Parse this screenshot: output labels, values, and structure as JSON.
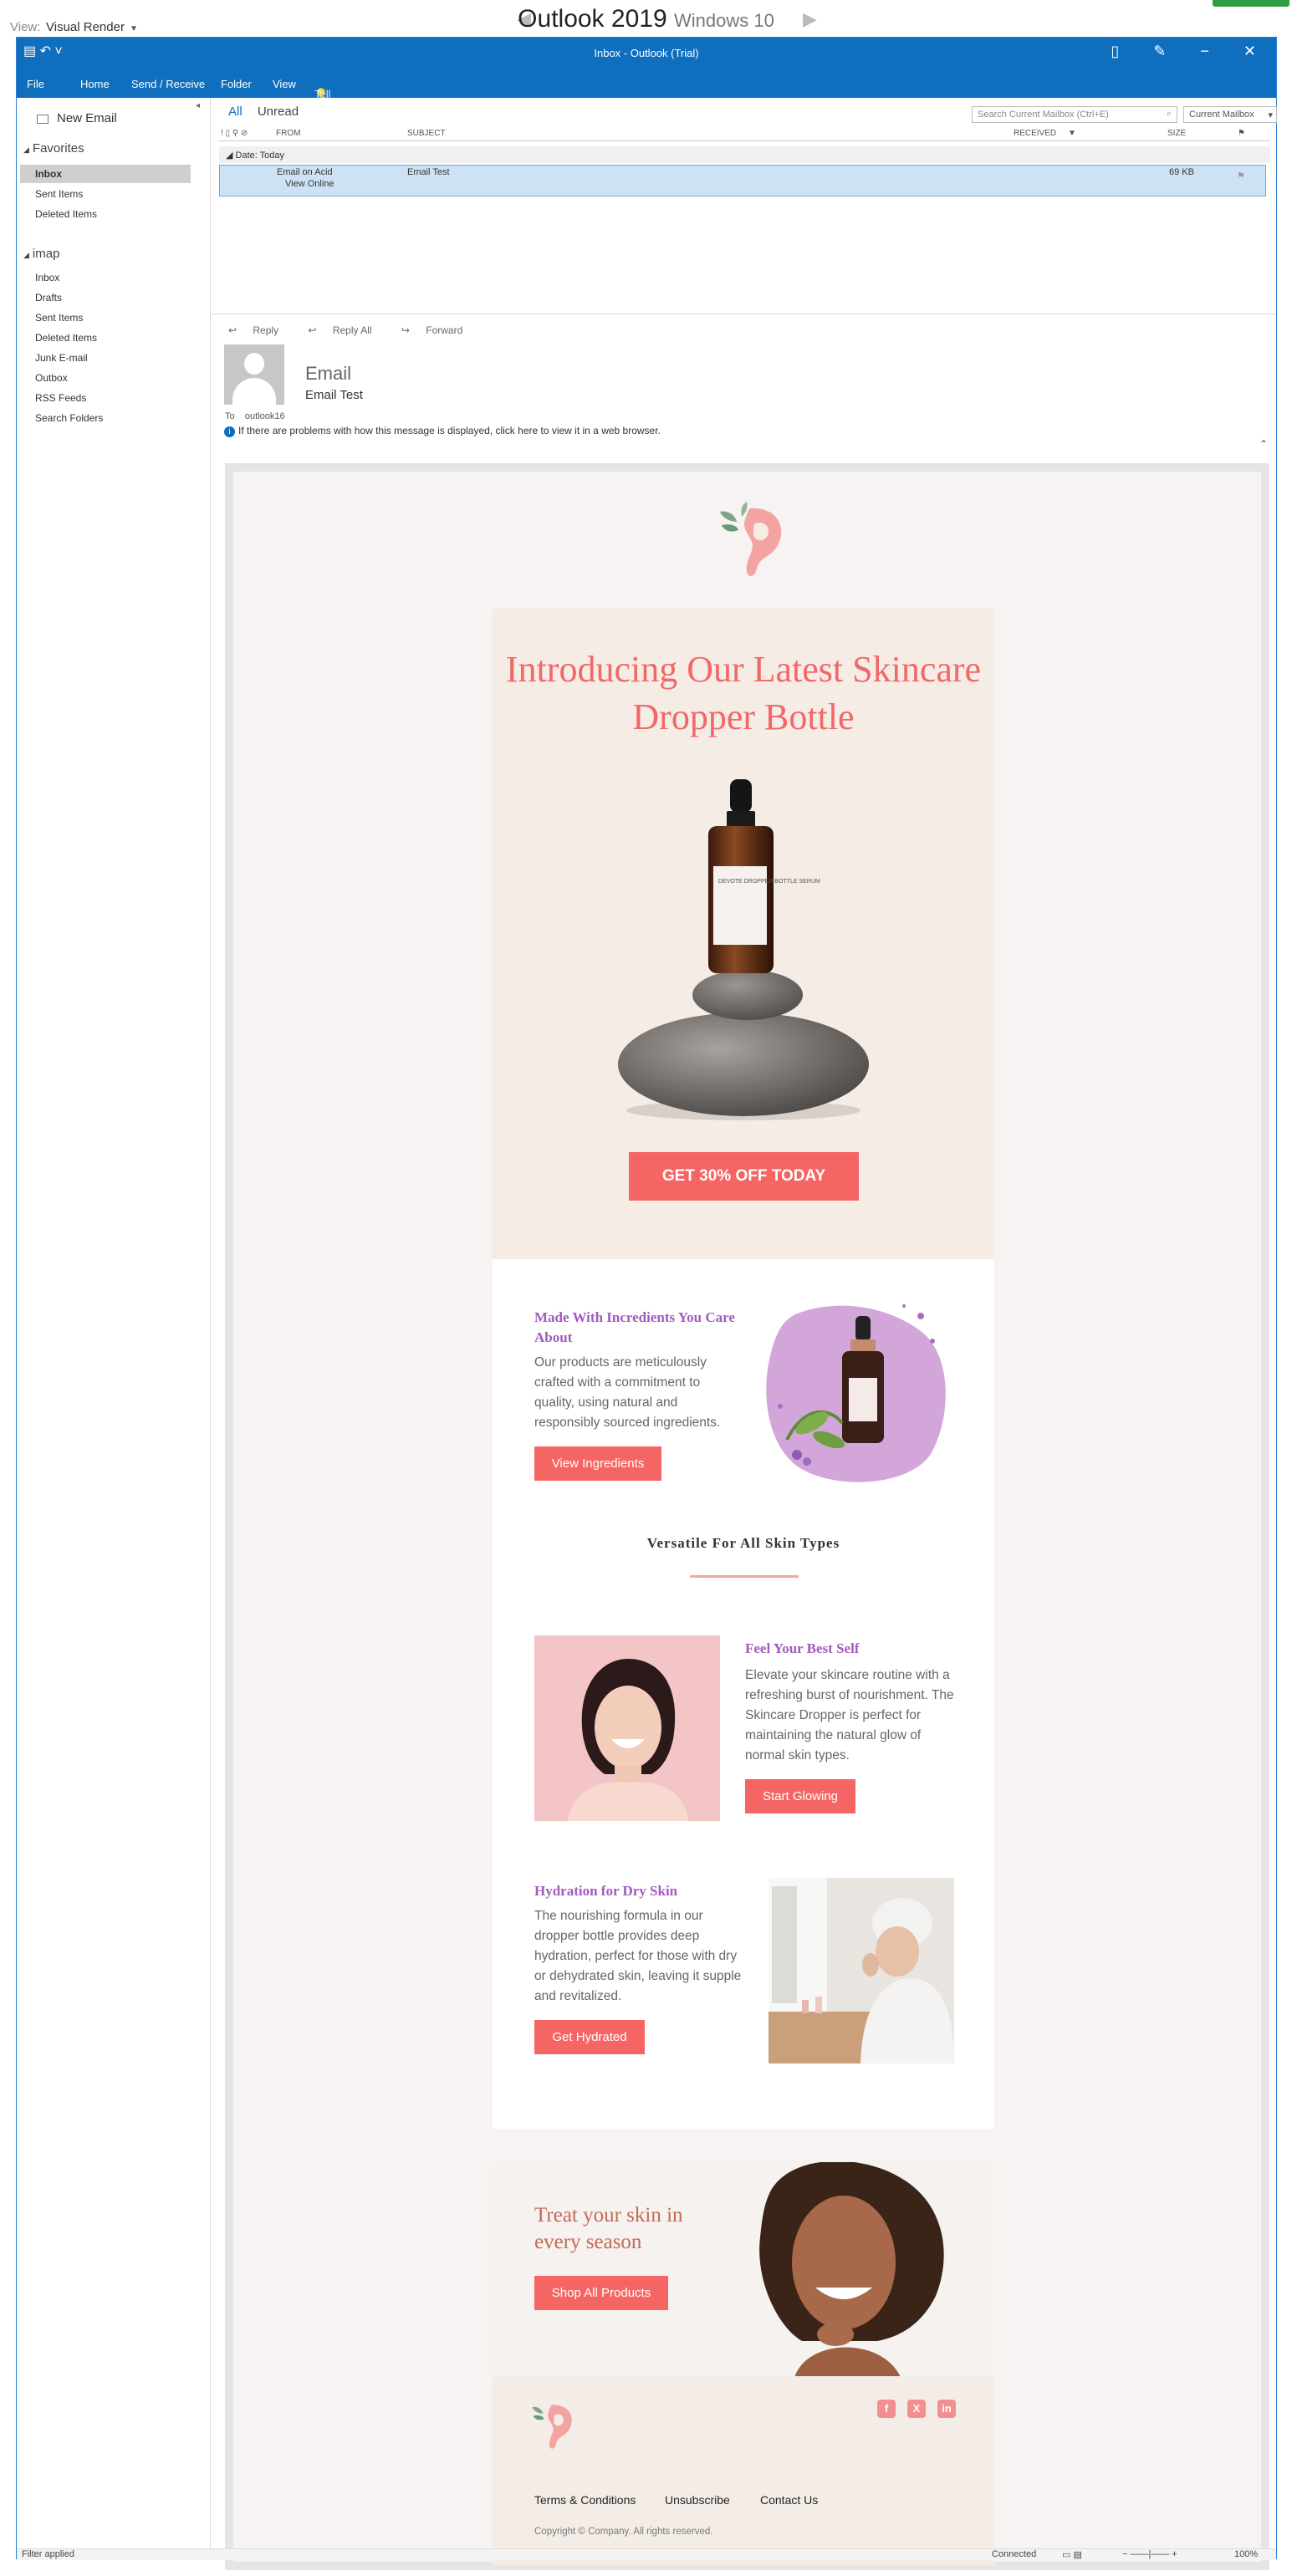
{
  "preview": {
    "view_label": "View:",
    "view_value": "Visual Render",
    "client": "Outlook 2019",
    "os": "Windows 10"
  },
  "window": {
    "title": "Inbox - Outlook (Trial)"
  },
  "ribbon": {
    "tabs": [
      "File",
      "Home",
      "Send / Receive",
      "Folder",
      "View"
    ],
    "tell_me": "Tell me what you want to do..."
  },
  "nav": {
    "new_email": "New Email",
    "favorites": "Favorites",
    "favorites_items": [
      "Inbox",
      "Sent Items",
      "Deleted Items"
    ],
    "account": "imap",
    "account_items": [
      "Inbox",
      "Drafts",
      "Sent Items",
      "Deleted Items",
      "Junk E-mail",
      "Outbox",
      "RSS Feeds",
      "Search Folders"
    ]
  },
  "list": {
    "filter_all": "All",
    "filter_unread": "Unread",
    "search_placeholder": "Search Current Mailbox (Ctrl+E)",
    "mailbox_scope": "Current Mailbox",
    "col_from": "FROM",
    "col_subject": "SUBJECT",
    "col_received": "RECEIVED",
    "col_size": "SIZE",
    "group": "Date: Today",
    "row": {
      "from": "Email on Acid",
      "view_online": "View Online",
      "subject": "Email Test",
      "size": "69 KB"
    }
  },
  "reading": {
    "actions": [
      "Reply",
      "Reply All",
      "Forward"
    ],
    "sender": "Email",
    "subject": "Email Test",
    "to_label": "To",
    "to_value": "outlook16",
    "info": "If there are problems with how this message is displayed, click here to view it in a web browser."
  },
  "email": {
    "hero_title": "Introducing Our Latest Skincare Dropper Bottle",
    "bottle_label": "DEVOTE DROPPER BOTTLE SERUM",
    "hero_cta": "GET 30% OFF TODAY",
    "ingredients_title": "Made With Incredients You Care About",
    "ingredients_body": "Our products are meticulously crafted with a commitment to quality, using natural and responsibly sourced ingredients.",
    "ingredients_cta": "View Ingredients",
    "versatile_title": "Versatile For All Skin Types",
    "best_self_title": "Feel Your Best Self",
    "best_self_body": "Elevate your skincare routine with a refreshing burst of nourishment. The Skincare Dropper is perfect for maintaining the natural glow of normal skin types.",
    "best_self_cta": "Start Glowing",
    "hydration_title": "Hydration for Dry Skin",
    "hydration_body": "The nourishing formula in our dropper bottle provides deep hydration, perfect for those with dry or dehydrated skin, leaving it supple and revitalized.",
    "hydration_cta": "Get Hydrated",
    "banner_title": "Treat your skin in every season",
    "banner_cta": "Shop All Products",
    "footer_links": [
      "Terms & Conditions",
      "Unsubscribe",
      "Contact Us"
    ],
    "copyright": "Copyright © Company.  All rights reserved.",
    "social": [
      "facebook-icon",
      "x-icon",
      "linkedin-icon"
    ]
  },
  "status": {
    "filter": "Filter applied",
    "connection": "Connected",
    "zoom": "100%"
  },
  "colors": {
    "outlook_blue": "#106ebe",
    "brand_coral": "#f56563",
    "accent_purple": "#a15bbd",
    "hero_bg": "#f6ece6"
  }
}
